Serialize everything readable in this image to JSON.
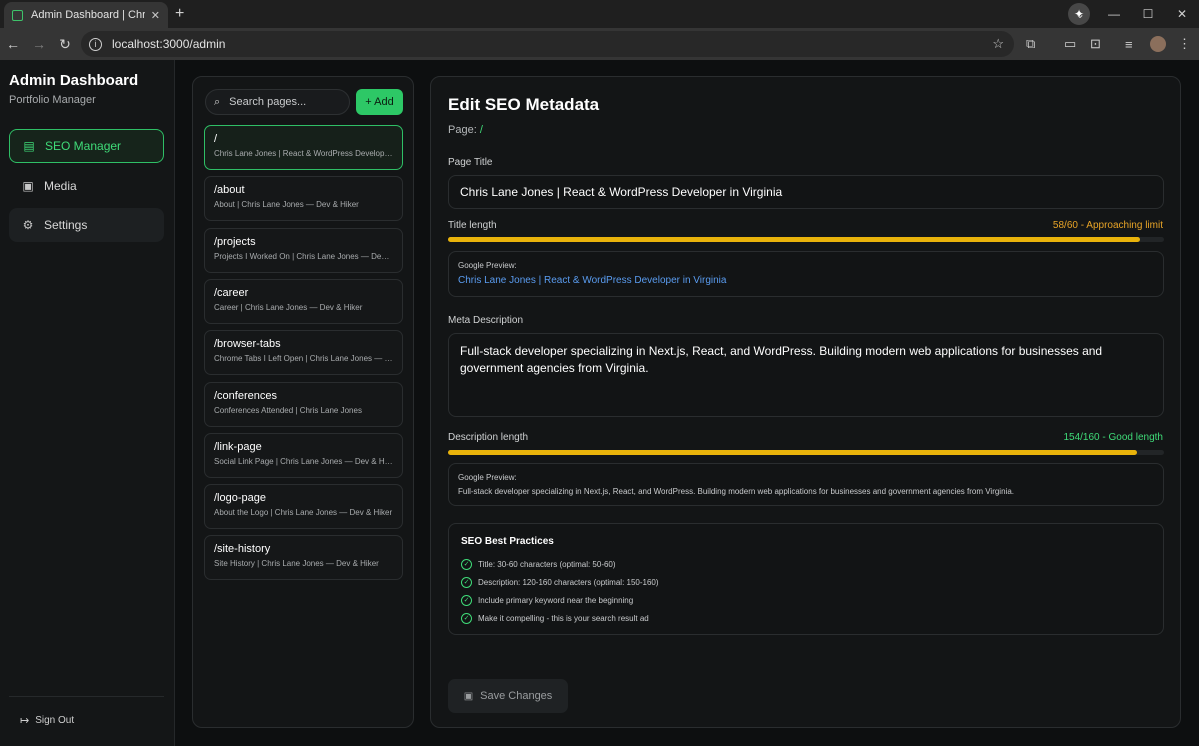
{
  "browser": {
    "tab_title": "Admin Dashboard | Chris Lane",
    "url": "localhost:3000/admin"
  },
  "sidebar": {
    "title": "Admin Dashboard",
    "subtitle": "Portfolio Manager",
    "items": [
      {
        "label": "SEO Manager",
        "icon": "document-icon",
        "active": true
      },
      {
        "label": "Media",
        "icon": "image-icon",
        "active": false
      },
      {
        "label": "Settings",
        "icon": "gear-icon",
        "active": false
      }
    ],
    "signout": "Sign Out"
  },
  "pages": {
    "search_placeholder": "Search pages...",
    "add_label": "+ Add",
    "items": [
      {
        "path": "/",
        "title": "Chris Lane Jones | React & WordPress Developer in Virginia"
      },
      {
        "path": "/about",
        "title": "About | Chris Lane Jones — Dev & Hiker"
      },
      {
        "path": "/projects",
        "title": "Projects I Worked On | Chris Lane Jones — Dev & Hiker"
      },
      {
        "path": "/career",
        "title": "Career | Chris Lane Jones — Dev & Hiker"
      },
      {
        "path": "/browser-tabs",
        "title": "Chrome Tabs I Left Open | Chris Lane Jones — Dev & Hiker"
      },
      {
        "path": "/conferences",
        "title": "Conferences Attended | Chris Lane Jones"
      },
      {
        "path": "/link-page",
        "title": "Social Link Page | Chris Lane Jones — Dev & Hiker"
      },
      {
        "path": "/logo-page",
        "title": "About the Logo | Chris Lane Jones — Dev & Hiker"
      },
      {
        "path": "/site-history",
        "title": "Site History | Chris Lane Jones — Dev & Hiker"
      }
    ]
  },
  "editor": {
    "heading": "Edit SEO Metadata",
    "page_label": "Page:",
    "page_value": "/",
    "title_label": "Page Title",
    "title_value": "Chris Lane Jones | React & WordPress Developer in Virginia",
    "title_length_label": "Title length",
    "title_count": "58/60 - Approaching limit",
    "title_fraction": 0.967,
    "title_count_color": "#e8a427",
    "preview_label": "Google Preview:",
    "preview_title": "Chris Lane Jones | React & WordPress Developer in Virginia",
    "desc_label": "Meta Description",
    "desc_value": "Full-stack developer specializing in Next.js, React, and WordPress. Building modern web applications for businesses and government agencies from Virginia.",
    "desc_length_label": "Description length",
    "desc_count": "154/160 - Good length",
    "desc_fraction": 0.9625,
    "desc_count_color": "#3fdb78",
    "preview_desc": "Full-stack developer specializing in Next.js, React, and WordPress. Building modern web applications for businesses and government agencies from Virginia.",
    "best_practices": {
      "heading": "SEO Best Practices",
      "items": [
        "Title: 30-60 characters (optimal: 50-60)",
        "Description: 120-160 characters (optimal: 150-160)",
        "Include primary keyword near the beginning",
        "Make it compelling - this is your search result ad"
      ]
    },
    "save_label": "Save Changes"
  }
}
